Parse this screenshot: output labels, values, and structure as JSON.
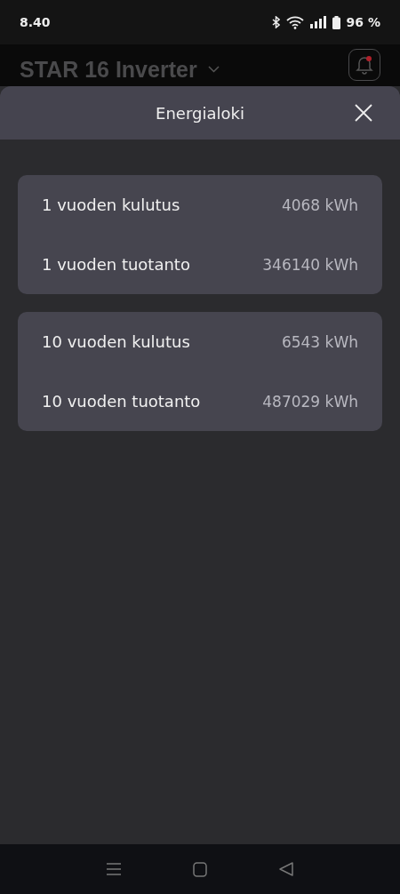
{
  "status_bar": {
    "time": "8.40",
    "battery": "96 %"
  },
  "app_header": {
    "title": "STAR 16 Inverter",
    "notification": true
  },
  "sheet": {
    "title": "Energialoki",
    "groups": [
      {
        "rows": [
          {
            "label": "1 vuoden kulutus",
            "value": "4068 kWh"
          },
          {
            "label": "1 vuoden tuotanto",
            "value": "346140 kWh"
          }
        ]
      },
      {
        "rows": [
          {
            "label": "10 vuoden kulutus",
            "value": "6543 kWh"
          },
          {
            "label": "10 vuoden tuotanto",
            "value": "487029 kWh"
          }
        ]
      }
    ]
  }
}
